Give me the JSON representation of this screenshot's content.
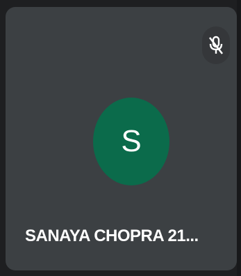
{
  "participant": {
    "name": "SANAYA CHOPRA 21...",
    "initial": "S",
    "avatar_color": "#0b6b4b",
    "mic_state": "muted",
    "mic_icon": "mic-off-icon"
  },
  "colors": {
    "tile_background": "#3c4043",
    "page_background": "#1e1f21"
  }
}
